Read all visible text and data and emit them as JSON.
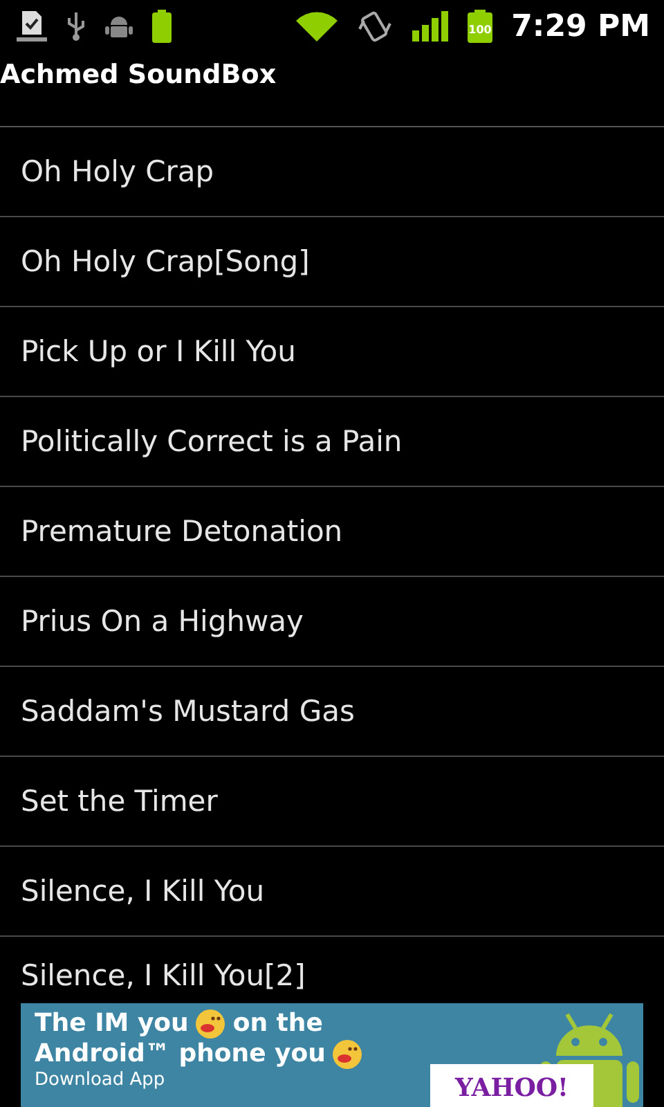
{
  "status_bar": {
    "time": "7:29 PM",
    "battery_level_text": "100"
  },
  "window": {
    "title": "Achmed SoundBox"
  },
  "list": [
    {
      "label": "Oh Holy Crap"
    },
    {
      "label": "Oh Holy Crap[Song]"
    },
    {
      "label": "Pick Up or I Kill You"
    },
    {
      "label": "Politically Correct is a Pain"
    },
    {
      "label": "Premature Detonation"
    },
    {
      "label": "Prius On a Highway"
    },
    {
      "label": "Saddam's Mustard Gas"
    },
    {
      "label": "Set the Timer"
    },
    {
      "label": "Silence, I Kill You"
    },
    {
      "label": "Silence, I Kill You[2]"
    }
  ],
  "ad": {
    "line_1_start": "The IM you",
    "line_1_end": "on the",
    "line_2": "Android™ phone you",
    "cta": "Download App",
    "brand": "YAHOO!"
  }
}
